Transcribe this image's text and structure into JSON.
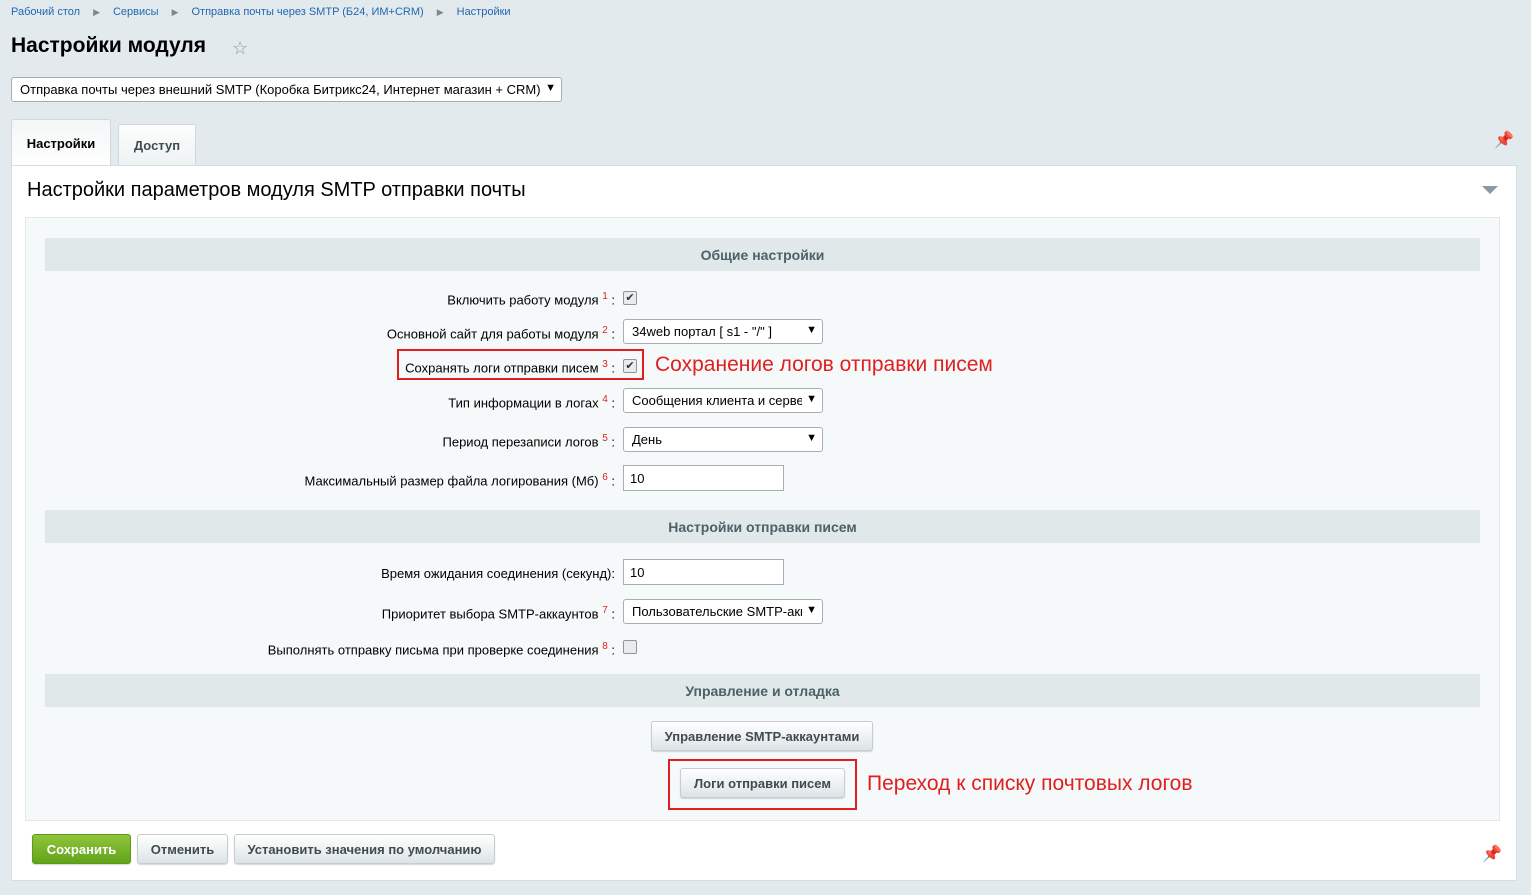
{
  "breadcrumbs": [
    "Рабочий стол",
    "Сервисы",
    "Отправка почты через SMTP (Б24, ИМ+CRM)",
    "Настройки"
  ],
  "page_title": "Настройки модуля",
  "module_select": "Отправка почты через внешний SMTP (Коробка Битрикс24, Интернет магазин + CRM)",
  "tabs": [
    "Настройки",
    "Доступ"
  ],
  "panel_title": "Настройки параметров модуля SMTP отправки почты",
  "sections": {
    "general": "Общие настройки",
    "sending": "Настройки отправки писем",
    "manage": "Управление и отладка"
  },
  "fields": {
    "enable": {
      "label": "Включить работу модуля",
      "num": "1",
      "checked": true
    },
    "site": {
      "label": "Основной сайт для работы модуля",
      "num": "2",
      "value": "34web портал [ s1 - \"/\" ]"
    },
    "save_logs": {
      "label": "Сохранять логи отправки писем",
      "num": "3",
      "checked": true
    },
    "log_type": {
      "label": "Тип информации в логах",
      "num": "4",
      "value": "Сообщения клиента и серве"
    },
    "log_period": {
      "label": "Период перезаписи логов",
      "num": "5",
      "value": "День"
    },
    "log_size": {
      "label": "Максимальный размер файла логирования (Мб)",
      "num": "6",
      "value": "10"
    },
    "timeout": {
      "label": "Время ожидания соединения (секунд):",
      "value": "10"
    },
    "priority": {
      "label": "Приоритет выбора SMTP-аккаунтов",
      "num": "7",
      "value": "Пользовательские SMTP-акк"
    },
    "send_on_check": {
      "label": "Выполнять отправку письма при проверке соединения",
      "num": "8",
      "checked": false
    }
  },
  "buttons": {
    "manage_accounts": "Управление SMTP-аккаунтами",
    "send_logs": "Логи отправки писем",
    "save": "Сохранить",
    "cancel": "Отменить",
    "defaults": "Установить значения по умолчанию"
  },
  "annotations": {
    "save_logs": "Сохранение логов отправки писем",
    "logs_link": "Переход к списку почтовых логов"
  },
  "colors": {
    "annotation": "#e01f1f",
    "save_button": "#6aad22",
    "link": "#2067b0"
  }
}
